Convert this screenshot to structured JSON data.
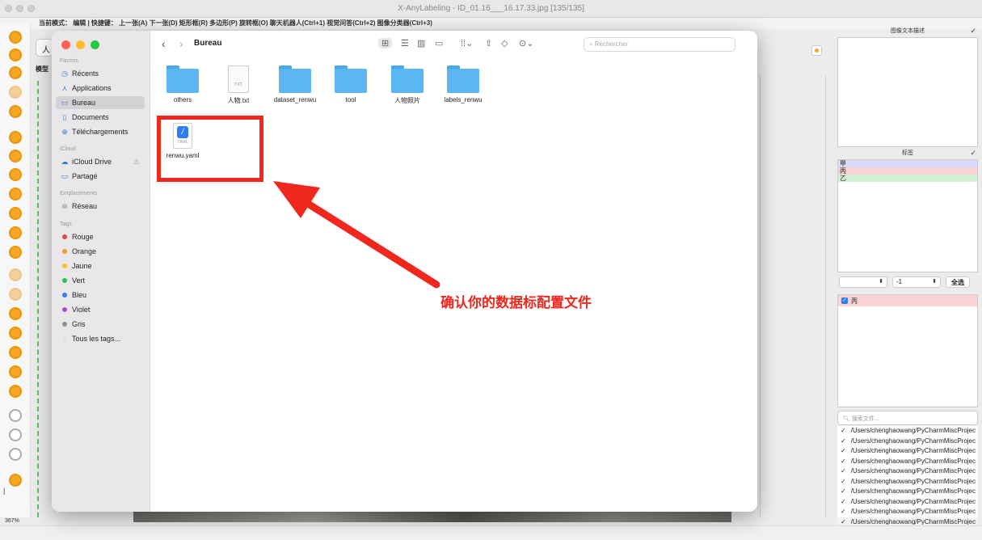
{
  "window": {
    "title": "X-AnyLabeling - ID_01.16___16.17.33.jpg [135/135]"
  },
  "toolbar": {
    "mode_text": "当前模式：  编辑 | 快捷键：  上一张(A) 下一张(D) 矩形框(R) 多边形(P) 旋转框(O) 聊天机器人(Ctrl+1) 视觉问答(Ctrl+2) 图像分类器(Ctrl+3)",
    "left_button": "人",
    "model_label": "模型"
  },
  "canvas": {
    "zoom": "367%"
  },
  "right_panel": {
    "description_title": "图像文本描述",
    "labels_title": "标签",
    "labels": [
      {
        "text": "甲",
        "color": "#d9d9f7"
      },
      {
        "text": "丙",
        "color": "#f7d3d3"
      },
      {
        "text": "乙",
        "color": "#d3f2d3"
      }
    ],
    "filter": {
      "left_value": "",
      "right_value": "-1",
      "select_all": "全选"
    },
    "shapes": [
      {
        "text": "丙",
        "checked": true
      }
    ],
    "search_placeholder": "搜索文件...",
    "files": [
      "/Users/chenghaowang/PyCharmMiscProjec",
      "/Users/chenghaowang/PyCharmMiscProjec",
      "/Users/chenghaowang/PyCharmMiscProjec",
      "/Users/chenghaowang/PyCharmMiscProjec",
      "/Users/chenghaowang/PyCharmMiscProjec",
      "/Users/chenghaowang/PyCharmMiscProjec",
      "/Users/chenghaowang/PyCharmMiscProjec",
      "/Users/chenghaowang/PyCharmMiscProjec",
      "/Users/chenghaowang/PyCharmMiscProjec",
      "/Users/chenghaowang/PyCharmMiscProjec"
    ]
  },
  "finder": {
    "path": "Bureau",
    "search_placeholder": "Rechercher",
    "sidebar": {
      "favoris_title": "Favoris",
      "favoris": [
        {
          "label": "Récents",
          "icon": "clock-icon"
        },
        {
          "label": "Applications",
          "icon": "applications-icon"
        },
        {
          "label": "Bureau",
          "icon": "desktop-icon",
          "selected": true
        },
        {
          "label": "Documents",
          "icon": "document-icon"
        },
        {
          "label": "Téléchargements",
          "icon": "download-icon"
        }
      ],
      "icloud_title": "iCloud",
      "icloud": [
        {
          "label": "iCloud Drive",
          "icon": "cloud-icon"
        },
        {
          "label": "Partagé",
          "icon": "shared-folder-icon"
        }
      ],
      "emplacements_title": "Emplacements",
      "emplacements": [
        {
          "label": "Réseau",
          "icon": "network-icon"
        }
      ],
      "tags_title": "Tags",
      "tags": [
        {
          "label": "Rouge",
          "color": "#f0443a"
        },
        {
          "label": "Orange",
          "color": "#f59a23"
        },
        {
          "label": "Jaune",
          "color": "#f5c623"
        },
        {
          "label": "Vert",
          "color": "#2ac14a"
        },
        {
          "label": "Bleu",
          "color": "#2f7cf6"
        },
        {
          "label": "Violet",
          "color": "#a64fd6"
        },
        {
          "label": "Gris",
          "color": "#8e8e93"
        },
        {
          "label": "Tous les tags...",
          "color": "none"
        }
      ]
    },
    "files": [
      {
        "name": "others",
        "kind": "folder"
      },
      {
        "name": "人物.txt",
        "kind": "txt",
        "ext": "TXT"
      },
      {
        "name": "dataset_renwu",
        "kind": "folder"
      },
      {
        "name": "tool",
        "kind": "folder"
      },
      {
        "name": "人物照片",
        "kind": "folder"
      },
      {
        "name": "labels_renwu",
        "kind": "folder"
      },
      {
        "name": "renwu.yaml",
        "kind": "yaml",
        "ext": "YAML"
      }
    ]
  },
  "annotation": {
    "text": "确认你的数据标配置文件",
    "color": "#f0271c"
  }
}
